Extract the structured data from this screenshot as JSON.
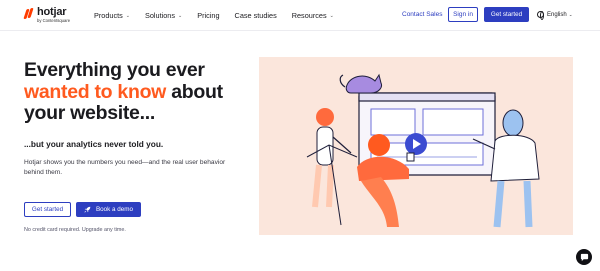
{
  "nav": {
    "logo_word": "hotjar",
    "logo_by": "by Contentsquare",
    "menu": [
      {
        "label": "Products",
        "has_dropdown": true
      },
      {
        "label": "Solutions",
        "has_dropdown": true
      },
      {
        "label": "Pricing",
        "has_dropdown": false
      },
      {
        "label": "Case studies",
        "has_dropdown": false
      },
      {
        "label": "Resources",
        "has_dropdown": true
      }
    ],
    "contact_sales": "Contact Sales",
    "sign_in": "Sign in",
    "get_started": "Get started",
    "language": "English",
    "chevron": "⌄"
  },
  "hero": {
    "title_part1": "Everything you ever",
    "title_highlight": "wanted to know",
    "title_part2": "about your website...",
    "subtitle": "...but your analytics never told you.",
    "description": "Hotjar shows you the numbers you need—and the real user behavior behind them.",
    "cta_primary": "Get started",
    "cta_secondary": "Book a demo",
    "footnote": "No credit card required. Upgrade any time."
  },
  "colors": {
    "brand_blue": "#2d3ec0",
    "brand_orange": "#ff5a1f",
    "illustration_bg": "#fbe6dc"
  },
  "icons": {
    "logo": "hotjar-logo-icon",
    "language": "globe-icon",
    "demo": "rocket-icon",
    "chat": "chat-bubble-icon"
  }
}
